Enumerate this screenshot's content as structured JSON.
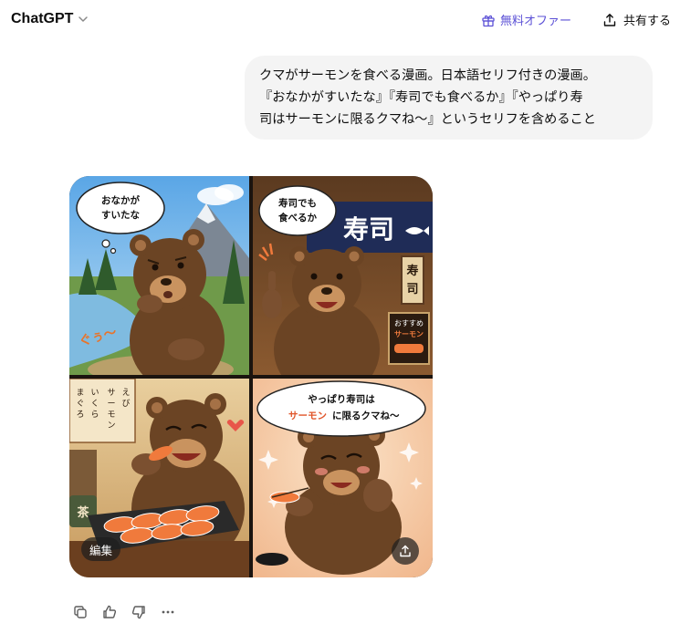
{
  "header": {
    "model_name": "ChatGPT",
    "offer_label": "無料オファー",
    "share_label": "共有する"
  },
  "conversation": {
    "user_message": "クマがサーモンを食べる漫画。日本語セリフ付きの漫画。\n『おなかがすいたな』『寿司でも食べるか』『やっぱり寿\n司はサーモンに限るクマね〜』というセリフを含めること"
  },
  "comic": {
    "panel1": {
      "bubble_line1": "おなかが",
      "bubble_line2": "すいたな",
      "sfx": "ぐぅ〜"
    },
    "panel2": {
      "bubble_line1": "寿司でも",
      "bubble_line2": "食べるか",
      "noren": "寿司",
      "sign": "寿司",
      "board_line1": "おすすめ",
      "board_line2": "サーモン"
    },
    "panel3": {
      "menu_col1": "まぐろ",
      "menu_col2": "いくら",
      "menu_col3": "サーモン",
      "menu_col4": "えび",
      "cup": "茶"
    },
    "panel4": {
      "bubble_line1": "やっぱり寿司は",
      "bubble_accent": "サーモン",
      "bubble_rest": "に限るクマね〜"
    }
  },
  "image_actions": {
    "edit_label": "編集"
  },
  "message_actions": [
    "copy-icon",
    "thumbs-up-icon",
    "thumbs-down-icon",
    "more-icon"
  ],
  "colors": {
    "accent": "#5b50d6",
    "bubble_bg": "#f4f4f4",
    "salmon": "#f07a3c",
    "bear": "#6b4424"
  }
}
